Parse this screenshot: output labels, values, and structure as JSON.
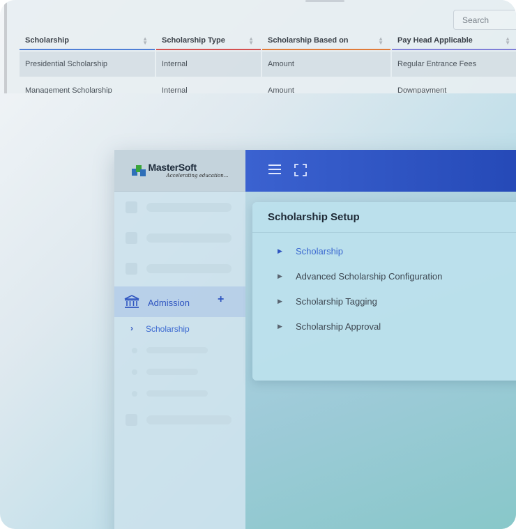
{
  "table": {
    "search_placeholder": "Search",
    "columns": [
      "Scholarship",
      "Scholarship Type",
      "Scholarship Based on",
      "Pay Head Applicable"
    ],
    "rows": [
      [
        "Presidential Scholarship",
        "Internal",
        "Amount",
        "Regular Entrance Fees"
      ],
      [
        "Management Scholarship",
        "Internal",
        "Amount",
        "Downpayment"
      ]
    ],
    "column_colors": [
      "#4f7fd6",
      "#d45050",
      "#e07b3a",
      "#7f7fd8"
    ]
  },
  "app": {
    "logo": {
      "name": "MasterSoft",
      "tagline": "Accelerating education..."
    },
    "sidebar": {
      "active_menu": {
        "label": "Admission",
        "icon": "institution-icon",
        "expand_symbol": "+"
      },
      "active_submenu": {
        "label": "Scholarship",
        "icon": "chevron-right-icon"
      }
    },
    "topbar": {
      "icons": [
        "hamburger-menu-icon",
        "fullscreen-icon"
      ],
      "color": "#2f52c4"
    },
    "card": {
      "title": "Scholarship Setup",
      "items": [
        {
          "label": "Scholarship",
          "active": true
        },
        {
          "label": "Advanced Scholarship Configuration",
          "active": false
        },
        {
          "label": "Scholarship Tagging",
          "active": false
        },
        {
          "label": "Scholarship Approval",
          "active": false
        }
      ]
    }
  }
}
